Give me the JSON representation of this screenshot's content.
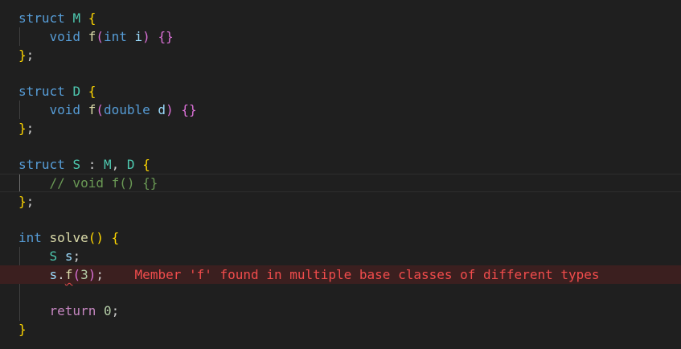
{
  "code": {
    "l1": {
      "kw": "struct",
      "name": "M",
      "brace": "{"
    },
    "l2": {
      "kw": "void",
      "fn": "f",
      "po": "(",
      "ptype": "int",
      "pname": "i",
      "pc": ")",
      "body": "{}"
    },
    "l3": {
      "close": "}",
      "semi": ";"
    },
    "l5": {
      "kw": "struct",
      "name": "D",
      "brace": "{"
    },
    "l6": {
      "kw": "void",
      "fn": "f",
      "po": "(",
      "ptype": "double",
      "pname": "d",
      "pc": ")",
      "body": "{}"
    },
    "l7": {
      "close": "}",
      "semi": ";"
    },
    "l9": {
      "kw": "struct",
      "name": "S",
      "colon": ":",
      "base1": "M",
      "comma": ",",
      "base2": "D",
      "brace": "{"
    },
    "l10": {
      "comment": "// void f() {}"
    },
    "l11": {
      "close": "}",
      "semi": ";"
    },
    "l13": {
      "rtype": "int",
      "fn": "solve",
      "parens": "()",
      "brace": "{"
    },
    "l14": {
      "type": "S",
      "var": "s",
      "semi": ";"
    },
    "l15": {
      "obj": "s",
      "dot": ".",
      "member": "f",
      "po": "(",
      "arg": "3",
      "pc": ")",
      "semi": ";"
    },
    "l17": {
      "kw": "return",
      "val": "0",
      "semi": ";"
    },
    "l18": {
      "close": "}"
    }
  },
  "diagnostic": {
    "message": "Member 'f' found in multiple base classes of different types",
    "color": "#f14c4c"
  },
  "theme": {
    "background": "#1f1f1f",
    "keyword": "#569cd6",
    "type": "#4ec9b0",
    "function": "#dcdcaa",
    "parameter": "#9cdcfe",
    "number": "#b5cea8",
    "control": "#c586c0",
    "comment": "#6a9955",
    "bracket_level1": "#ffd700",
    "bracket_level2": "#da70d6"
  }
}
